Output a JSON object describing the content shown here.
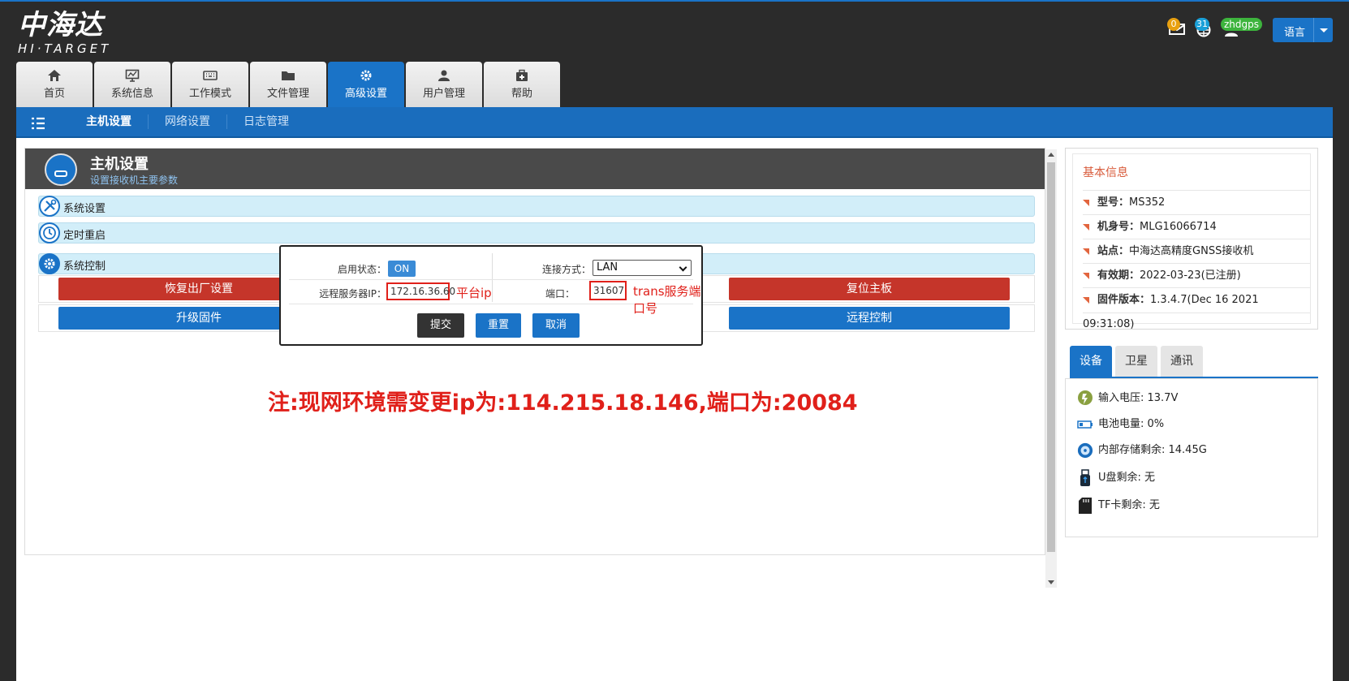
{
  "brand": {
    "name_cn": "中海达",
    "name_en": "HI·TARGET"
  },
  "header": {
    "mail_count": "0",
    "globe_count": "31",
    "user_name": "zhdgps",
    "language_label": "语言"
  },
  "nav_tabs": [
    {
      "label": "首页",
      "icon": "home-icon"
    },
    {
      "label": "系统信息",
      "icon": "monitor-icon"
    },
    {
      "label": "工作模式",
      "icon": "keyboard-icon"
    },
    {
      "label": "文件管理",
      "icon": "folder-icon"
    },
    {
      "label": "高级设置",
      "icon": "gear-icon",
      "active": true
    },
    {
      "label": "用户管理",
      "icon": "user-icon"
    },
    {
      "label": "帮助",
      "icon": "medkit-icon"
    }
  ],
  "sub_nav": [
    {
      "label": "主机设置",
      "active": true
    },
    {
      "label": "网络设置"
    },
    {
      "label": "日志管理"
    }
  ],
  "panel": {
    "title": "主机设置",
    "subtitle": "设置接收机主要参数",
    "sections": {
      "system_settings": "系统设置",
      "timed_restart": "定时重启",
      "system_control": "系统控制"
    },
    "buttons": {
      "factory_reset": "恢复出厂设置",
      "reset_board": "复位主板",
      "upgrade_firmware": "升级固件",
      "remote_control": "远程控制"
    }
  },
  "modal": {
    "enable_label": "启用状态：",
    "enable_value": "ON",
    "connection_label": "连接方式：",
    "connection_value": "LAN",
    "server_ip_label": "远程服务器IP：",
    "server_ip_value": "172.16.36.60",
    "server_ip_note": "平台ip",
    "port_label": "端口：",
    "port_value": "31607",
    "port_note": "trans服务端口号",
    "submit": "提交",
    "reset": "重置",
    "cancel": "取消"
  },
  "notice": "注:现网环境需变更ip为:114.215.18.146,端口为:20084",
  "basic_info": {
    "title": "基本信息",
    "rows": [
      {
        "key": "型号：",
        "value": "MS352"
      },
      {
        "key": "机身号：",
        "value": "MLG16066714"
      },
      {
        "key": "站点：",
        "value": "中海达高精度GNSS接收机"
      },
      {
        "key": "有效期：",
        "value": "2022-03-23(已注册)"
      },
      {
        "key": "固件版本：",
        "value": "1.3.4.7(Dec 16 2021 09:31:08)"
      }
    ]
  },
  "device_tabs": [
    {
      "label": "设备",
      "active": true
    },
    {
      "label": "卫星"
    },
    {
      "label": "通讯"
    }
  ],
  "device_info": [
    {
      "label": "输入电压: 13.7V",
      "icon": "voltage-icon"
    },
    {
      "label": "电池电量: 0%",
      "icon": "battery-icon"
    },
    {
      "label": "内部存储剩余: 14.45G",
      "icon": "storage-icon"
    },
    {
      "label": "U盘剩余: 无",
      "icon": "usb-icon"
    },
    {
      "label": "TF卡剩余: 无",
      "icon": "sdcard-icon"
    }
  ],
  "colors": {
    "primary": "#1a73c7",
    "danger": "#c5352a",
    "accent": "#e2653e",
    "annotation": "#e0201a"
  }
}
